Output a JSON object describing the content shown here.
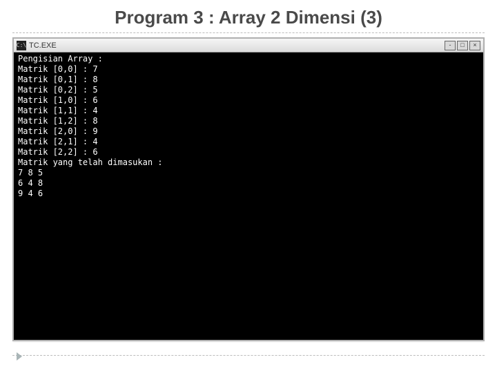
{
  "slide": {
    "title": "Program 3 : Array 2 Dimensi (3)"
  },
  "window": {
    "icon_text": "C:\\",
    "title": "TC.EXE",
    "min_label": "-",
    "max_label": "□",
    "close_label": "×"
  },
  "console": {
    "header": "Pengisian Array :",
    "entries": [
      {
        "prompt": "Matrik [0,0] :",
        "value": "7"
      },
      {
        "prompt": "Matrik [0,1] :",
        "value": "8"
      },
      {
        "prompt": "Matrik [0,2] :",
        "value": "5"
      },
      {
        "prompt": "Matrik [1,0] :",
        "value": "6"
      },
      {
        "prompt": "Matrik [1,1] :",
        "value": "4"
      },
      {
        "prompt": "Matrik [1,2] :",
        "value": "8"
      },
      {
        "prompt": "Matrik [2,0] :",
        "value": "9"
      },
      {
        "prompt": "Matrik [2,1] :",
        "value": "4"
      },
      {
        "prompt": "Matrik [2,2] :",
        "value": "6"
      }
    ],
    "result_header": "Matrik yang telah dimasukan :",
    "matrix_rows": [
      "7 8 5",
      "6 4 8",
      "9 4 6"
    ]
  }
}
